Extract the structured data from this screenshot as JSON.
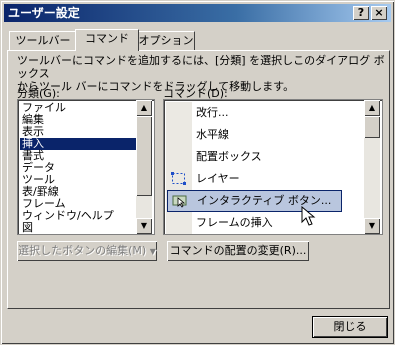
{
  "window": {
    "title": "ユーザー設定",
    "help_label": "?",
    "close_label": "×"
  },
  "tabs": [
    {
      "label": "ツールバー"
    },
    {
      "label": "コマンド"
    },
    {
      "label": "オプション"
    }
  ],
  "description_line1": "ツールバーにコマンドを追加するには、[分類] を選択しこのダイアログ ボックス",
  "description_line2": "からツール バーにコマンドをドラッグして移動します。",
  "categories_label": "分類(G):",
  "commands_label": "コマンド(D):",
  "categories": [
    "ファイル",
    "編集",
    "表示",
    "挿入",
    "書式",
    "データ",
    "ツール",
    "表/罫線",
    "フレーム",
    "ウィンドウ/ヘルプ",
    "図"
  ],
  "selected_category": "挿入",
  "commands": [
    {
      "label": "改行...",
      "icon": "none"
    },
    {
      "label": "水平線",
      "icon": "none"
    },
    {
      "label": "配置ボックス",
      "icon": "none"
    },
    {
      "label": "レイヤー",
      "icon": "layer-icon"
    },
    {
      "label": "インタラクティブ ボタン...",
      "icon": "interactive-button-icon"
    },
    {
      "label": "フレームの挿入",
      "icon": "none"
    }
  ],
  "highlighted_command": "インタラクティブ ボタン...",
  "buttons": {
    "edit_selected": "選択したボタンの編集(M)",
    "rearrange": "コマンドの配置の変更(R)...",
    "close": "閉じる"
  }
}
